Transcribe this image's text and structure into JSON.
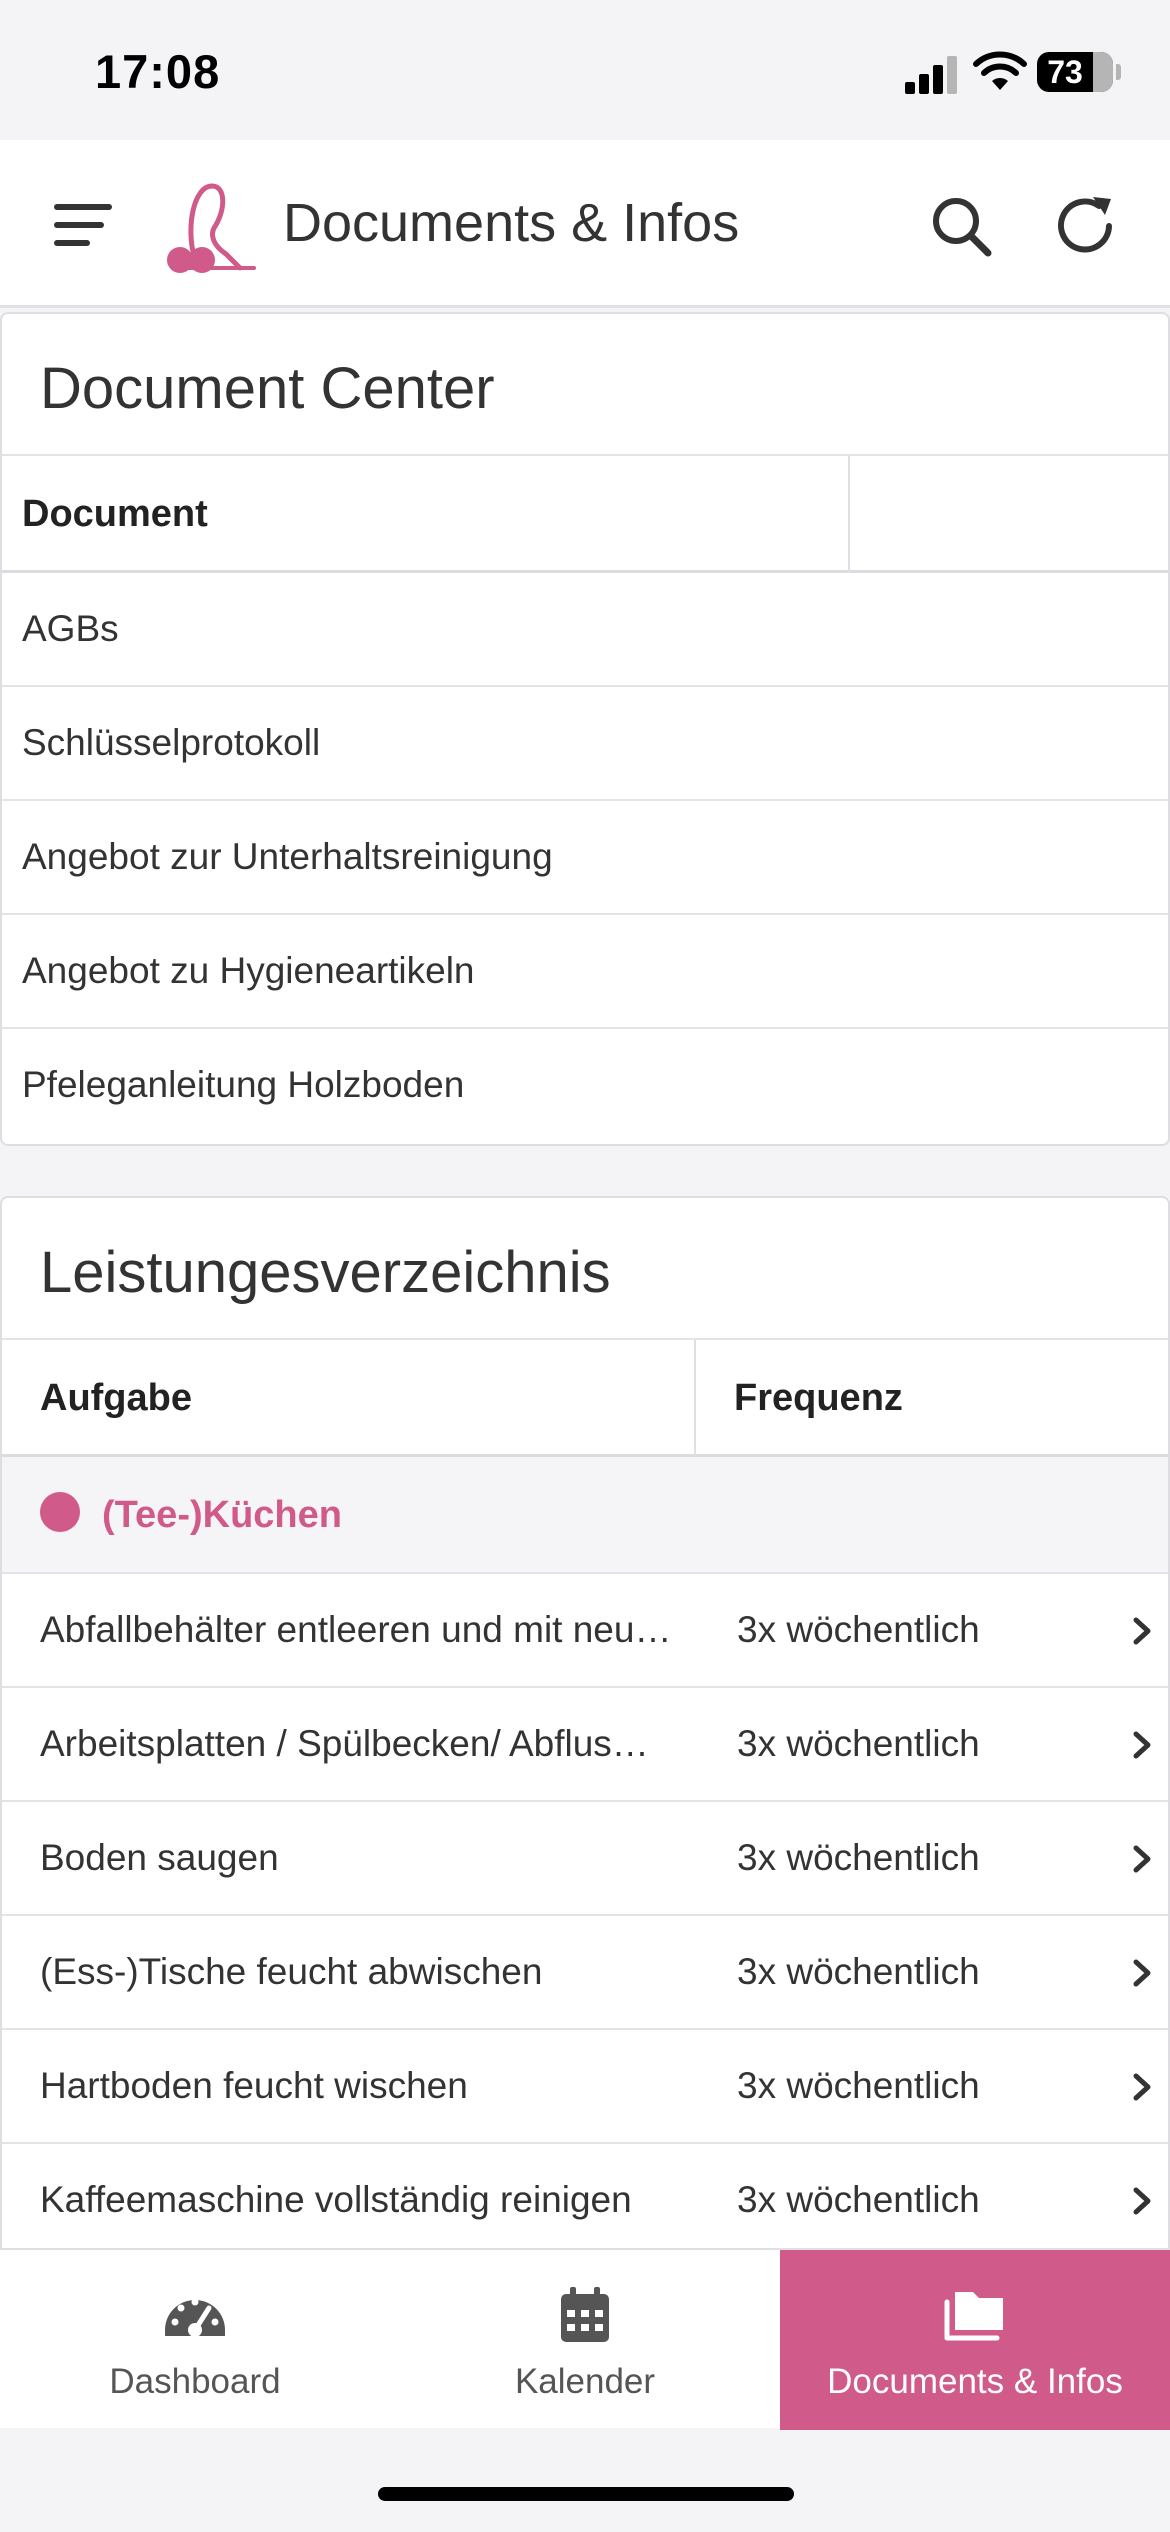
{
  "status_bar": {
    "time": "17:08",
    "battery": "73"
  },
  "header": {
    "title": "Documents & Infos"
  },
  "document_center": {
    "title": "Document Center",
    "column_header": "Document",
    "rows": [
      "AGBs",
      "Schlüsselprotokoll",
      "Angebot zur Unterhaltsreinigung",
      "Angebot zu Hygieneartikeln",
      "Pfeleganleitung Holzboden"
    ]
  },
  "leistungsverzeichnis": {
    "title": "Leistungesverzeichnis",
    "col_task": "Aufgabe",
    "col_freq": "Frequenz",
    "group": "(Tee-)Küchen",
    "rows": [
      {
        "task": "Abfallbehälter entleeren und mit neu…",
        "freq": "3x wöchentlich"
      },
      {
        "task": "Arbeitsplatten / Spülbecken/ Abflus…",
        "freq": "3x wöchentlich"
      },
      {
        "task": "Boden saugen",
        "freq": "3x wöchentlich"
      },
      {
        "task": "(Ess-)Tische feucht abwischen",
        "freq": "3x wöchentlich"
      },
      {
        "task": "Hartboden feucht wischen",
        "freq": "3x wöchentlich"
      },
      {
        "task": "Kaffeemaschine vollständig reinigen",
        "freq": "3x wöchentlich"
      }
    ]
  },
  "bottom_nav": {
    "items": [
      {
        "label": "Dashboard",
        "icon": "gauge-icon"
      },
      {
        "label": "Kalender",
        "icon": "calendar-icon"
      },
      {
        "label": "Documents & Infos",
        "icon": "folder-icon"
      }
    ],
    "active": "Documents & Infos"
  },
  "colors": {
    "accent": "#d05a8a"
  }
}
